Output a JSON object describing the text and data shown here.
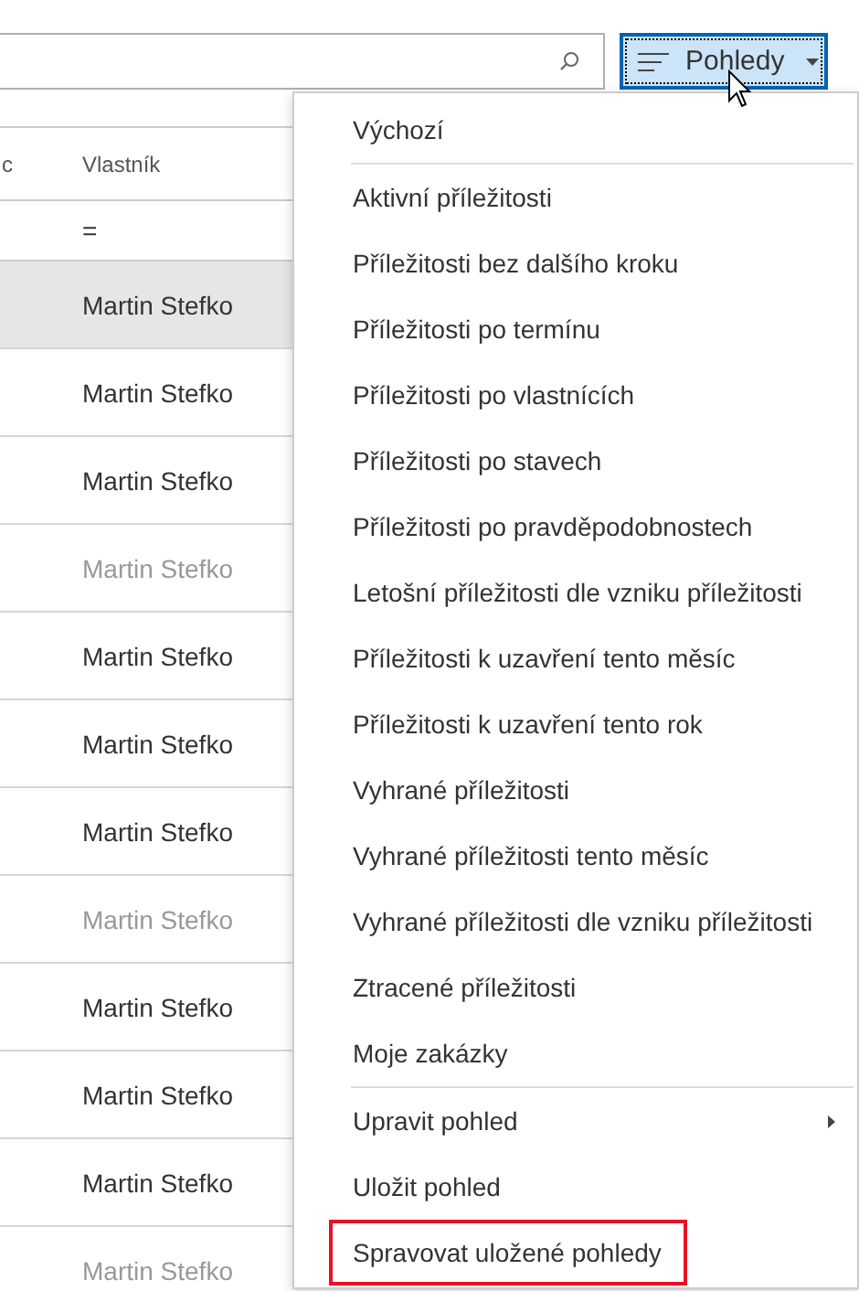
{
  "toolbar": {
    "views_button": {
      "label": "Pohledy",
      "expanded": true
    }
  },
  "table": {
    "columns": [
      {
        "label": "c"
      },
      {
        "label": "Vlastník"
      }
    ],
    "filter": "=",
    "rows": [
      {
        "owner": "Martin Stefko",
        "selected": true,
        "dimmed": false
      },
      {
        "owner": "Martin Stefko",
        "selected": false,
        "dimmed": false
      },
      {
        "owner": "Martin Stefko",
        "selected": false,
        "dimmed": false
      },
      {
        "owner": "Martin Stefko",
        "selected": false,
        "dimmed": true
      },
      {
        "owner": "Martin Stefko",
        "selected": false,
        "dimmed": false
      },
      {
        "owner": "Martin Stefko",
        "selected": false,
        "dimmed": false
      },
      {
        "owner": "Martin Stefko",
        "selected": false,
        "dimmed": false
      },
      {
        "owner": "Martin Stefko",
        "selected": false,
        "dimmed": true
      },
      {
        "owner": "Martin Stefko",
        "selected": false,
        "dimmed": false
      },
      {
        "owner": "Martin Stefko",
        "selected": false,
        "dimmed": false
      },
      {
        "owner": "Martin Stefko",
        "selected": false,
        "dimmed": false
      },
      {
        "owner": "Martin Stefko",
        "selected": false,
        "dimmed": true
      }
    ]
  },
  "menu": {
    "items": [
      {
        "label": "Výchozí",
        "divider_after": true,
        "submenu": false,
        "highlighted": false
      },
      {
        "label": "Aktivní příležitosti",
        "divider_after": false,
        "submenu": false,
        "highlighted": false
      },
      {
        "label": "Příležitosti bez dalšího kroku",
        "divider_after": false,
        "submenu": false,
        "highlighted": false
      },
      {
        "label": "Příležitosti po termínu",
        "divider_after": false,
        "submenu": false,
        "highlighted": false
      },
      {
        "label": "Příležitosti po vlastnících",
        "divider_after": false,
        "submenu": false,
        "highlighted": false
      },
      {
        "label": "Příležitosti po stavech",
        "divider_after": false,
        "submenu": false,
        "highlighted": false
      },
      {
        "label": "Příležitosti po pravděpodobnostech",
        "divider_after": false,
        "submenu": false,
        "highlighted": false
      },
      {
        "label": "Letošní příležitosti dle vzniku příležitosti",
        "divider_after": false,
        "submenu": false,
        "highlighted": false
      },
      {
        "label": "Příležitosti k uzavření tento měsíc",
        "divider_after": false,
        "submenu": false,
        "highlighted": false
      },
      {
        "label": "Příležitosti k uzavření tento rok",
        "divider_after": false,
        "submenu": false,
        "highlighted": false
      },
      {
        "label": "Vyhrané příležitosti",
        "divider_after": false,
        "submenu": false,
        "highlighted": false
      },
      {
        "label": "Vyhrané příležitosti tento měsíc",
        "divider_after": false,
        "submenu": false,
        "highlighted": false
      },
      {
        "label": "Vyhrané příležitosti dle vzniku příležitosti",
        "divider_after": false,
        "submenu": false,
        "highlighted": false
      },
      {
        "label": "Ztracené příležitosti",
        "divider_after": false,
        "submenu": false,
        "highlighted": false
      },
      {
        "label": "Moje zakázky",
        "divider_after": true,
        "submenu": false,
        "highlighted": false
      },
      {
        "label": "Upravit pohled",
        "divider_after": false,
        "submenu": true,
        "highlighted": false
      },
      {
        "label": "Uložit pohled",
        "divider_after": false,
        "submenu": false,
        "highlighted": false
      },
      {
        "label": "Spravovat uložené pohledy",
        "divider_after": false,
        "submenu": false,
        "highlighted": true
      }
    ]
  }
}
